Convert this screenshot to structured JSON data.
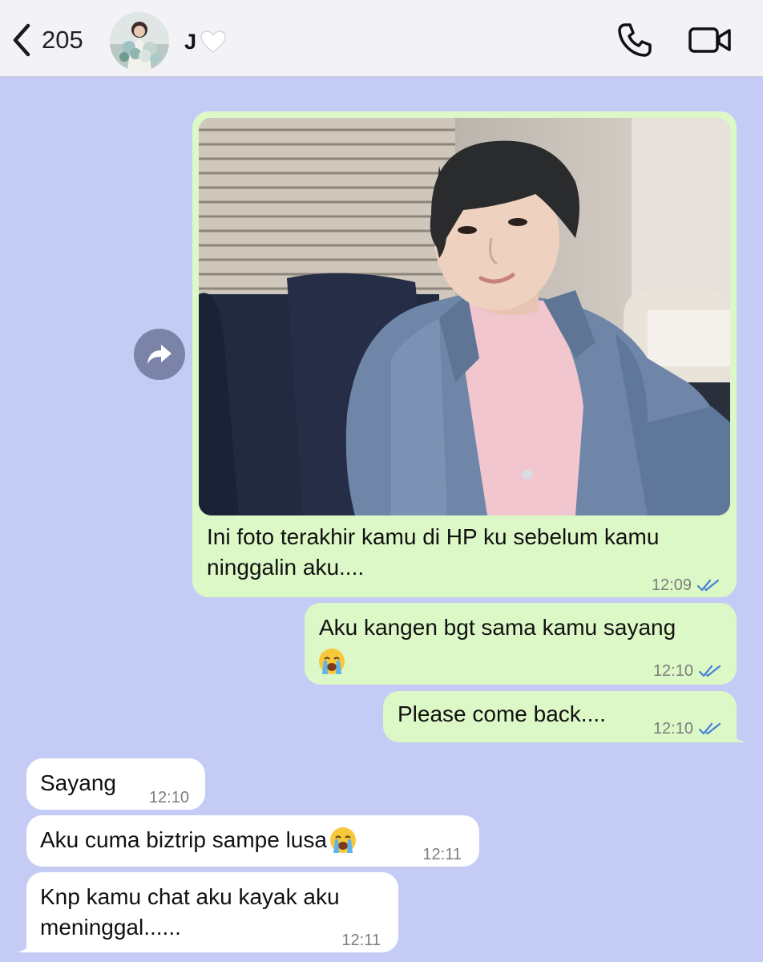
{
  "header": {
    "back_count": "205",
    "contact_name": "J",
    "contact_emoji": "white-heart",
    "icons": [
      "back-chevron-icon",
      "phone-icon",
      "video-camera-icon"
    ]
  },
  "colors": {
    "chat_background": "#c4ccf6",
    "outgoing_bubble": "#dcf8c6",
    "incoming_bubble": "#ffffff",
    "read_ticks": "#4a7fd6"
  },
  "messages": [
    {
      "direction": "outgoing",
      "type": "photo",
      "caption": "Ini foto terakhir kamu di HP ku sebelum kamu ninggalin aku....",
      "time": "12:09",
      "status": "read"
    },
    {
      "direction": "outgoing",
      "text": "Aku kangen bgt sama kamu sayang",
      "emoji": "loudly-crying-face",
      "time": "12:10",
      "status": "read"
    },
    {
      "direction": "outgoing",
      "text": "Please come back....",
      "time": "12:10",
      "status": "read"
    },
    {
      "direction": "incoming",
      "text": "Sayang",
      "time": "12:10"
    },
    {
      "direction": "incoming",
      "text": "Aku cuma biztrip sampe lusa",
      "emoji": "loudly-crying-face",
      "time": "12:11"
    },
    {
      "direction": "incoming",
      "text": "Knp kamu chat aku kayak aku meninggal......",
      "time": "12:11"
    }
  ]
}
